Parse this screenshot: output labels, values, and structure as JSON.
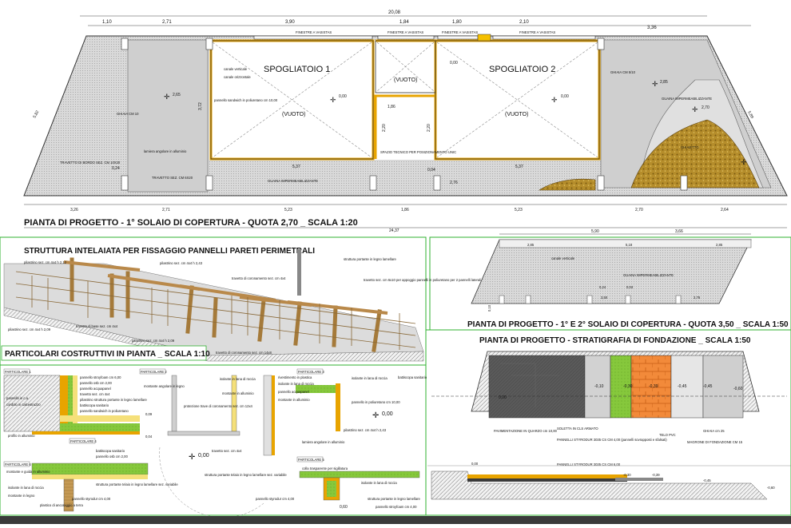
{
  "plan1": {
    "dims_top": {
      "total": "20,08",
      "d1": "1,10",
      "d2": "2,71",
      "d3": "3,90",
      "d4": "1,84",
      "d5": "1,80",
      "d6": "2,10",
      "d7": "3,36"
    },
    "windows": [
      "FINESTRE A VASISTAS",
      "FINESTRE A VASISTAS",
      "FINESTRE A VASISTAS",
      "FINESTRE A VASISTAS"
    ],
    "rooms": {
      "room1": "SPOGLIATOIO 1",
      "room2": "SPOGLIATOIO 2"
    },
    "void": "(VUOTO)",
    "levels": {
      "l265": "2,65",
      "l000": "0,00",
      "l285": "2,85",
      "l270": "2,70",
      "l276": "2,76",
      "l175": "1,75",
      "l024": "0,24",
      "l004": "0,04"
    },
    "side_dims": {
      "left": "5,82",
      "right": "5,89",
      "h372": "3,72",
      "h220": "2,20",
      "w186": "1,86"
    },
    "labels": {
      "trav_bordo": "TRAVETTO DI BORDO SEZ. CM 10X20",
      "pannello_sandwich": "pannello sandwich in poliuretano cm 10,00",
      "lamiera": "lamiera angolare in alluminio",
      "trav_6x20": "TRAVETTO SEZ. CM 6X20",
      "guaina_imp": "GUAINA IMPERMEABILIZZANTE",
      "guaina_imp2": "GUAINA IMPERMEABILIZZANTE",
      "spazio_tecnico": "SPAZIO TECNICO PER POSIZIONAMENTO UNIC",
      "ghiaia": "GHIAIA CM 10",
      "ghiaia_right": "GHIAIA CM 5/10",
      "ghiaietto": "GHIAIETTO",
      "tiny1": "canale verticale",
      "tiny2": "canale orizzontale"
    },
    "dims_bottom": {
      "b1": "3,26",
      "b2": "2,71",
      "b3": "5,23",
      "b4": "1,86",
      "b5": "5,23",
      "b6": "2,70",
      "b7": "2,64",
      "total": "24,37",
      "m537a": "5,37",
      "m537b": "5,37"
    },
    "title": "PIANTA DI PROGETTO - 1° SOLAIO DI COPERTURA - QUOTA 2,70 _ SCALA 1:20"
  },
  "frame": {
    "title": "STRUTTURA INTELAIATA PER FISSAGGIO PANNELLI PARETI PERIMETRALI",
    "labels": {
      "a": "pilastrino sez. cm 4x4 h 2,12",
      "b": "pilastrino sez. cm 4x4 h 2,43",
      "c": "travetto di coronamento sez. cm 4x4",
      "d": "struttura portante in legno lamellare",
      "e": "travetto sez. cm 6x10 per appoggio pannelli in poliuretano per 2 pannelli laterali e nel prospetto occidentale",
      "f": "pilastrino sez. cm 4x4 h 2,09",
      "g": "travetto di base sez. cm 4x4",
      "h": "pilastrino sez. cm 4x4 h 2,09",
      "i": "travetto di coronamento sez. cm 14x8"
    }
  },
  "plan2": {
    "dims": {
      "a": "5,90",
      "b": "3,66",
      "c": "2,85",
      "d": "5,18",
      "e": "2,85"
    },
    "labels": {
      "canale": "canale verticale",
      "guaina": "GUAINA IMPERMEABILIZZANTE"
    },
    "levels": {
      "a": "0,24",
      "b": "0,04",
      "c": "3,50",
      "d": "2,76",
      "e": "0,10"
    },
    "title": "PIANTA DI PROGETTO - 1° E 2° SOLAIO DI COPERTURA - QUOTA 3,50 _ SCALA 1:50"
  },
  "particolari": {
    "title": "PARTICOLARI COSTRUTTIVI IN PIANTA _ SCALA 1:10",
    "tags": [
      "PARTICOLARE 1",
      "PARTICOLARE 2",
      "PARTICOLARE 3",
      "PARTICOLARE 4",
      "PARTICOLARE 5",
      "PARTICOLARE 6"
    ],
    "levels": {
      "a": "0,00",
      "b": "0,00"
    },
    "labels": {
      "p1a": "pannello stroyfoam cm 6,00",
      "p1b": "pannello osb cm 2,00",
      "p1c": "pannello acquapanel",
      "p1d": "travetto sez. cm 4x4",
      "p1e": "pilastrino struttura portante in legno lamellare",
      "p1f": "battiscopa sanitario",
      "p1g": "pannello sandwich in poliuretano",
      "p1h": "cordolo in calcestruzzo",
      "p1i": "pannello in c.a.",
      "p1j": "profilo in alluminio",
      "p2a": "isolante in lana di roccia",
      "p2b": "montante angolare in legno",
      "p2c": "montante in alluminio",
      "p2d": "protezione trave di coronamento sez. cm 12x4",
      "p2e": "montante e guida in alluminio",
      "p3a": "rivestimento in plastica",
      "p3b": "isolante in lana di roccia",
      "p3c": "pannello acquapanel",
      "p3d": "montante in alluminio",
      "p4a": "isolante in lana di roccia",
      "p4b": "pannello in poliuretano cm 10,00",
      "p4c": "pilastrino sez. cm 4x4 h 2,43",
      "p4d": "lamiera angolare in alluminio",
      "p5a": "colla trasparente per sigillatura",
      "p5b": "isolante in lana di roccia",
      "p5c": "struttura portante in legno lamellare",
      "p5d": "pannello stroyfoam cm 4,00",
      "p6a": "struttura portante telaio in legno lamellare sez. variabile",
      "p6b": "montante in legno",
      "p6c": "pannello styrodur cm 4,00",
      "p6d": "plastico di ancoraggio a terra"
    },
    "dims": {
      "d1": "0,09",
      "d2": "0,04",
      "d3": "0,40",
      "d4": "0,09",
      "d5": "0,60"
    }
  },
  "fondazione": {
    "title": "PIANTA DI PROGETTO - STRATIGRAFIA DI FONDAZIONE _ SCALA 1:50",
    "levels": {
      "a": "0,00",
      "b": "-0,10",
      "c": "-0,30",
      "d": "-0,39",
      "e": "-0,45",
      "f": "-0,45",
      "g": "-0,60"
    },
    "labels": {
      "a": "PAVIMENTAZIONE IN QUARZO cm 10,00",
      "b": "SOLETTA IN CLS ARMATO",
      "c": "PANNELLI STYRODUR 3035 CS CM 4,00 (pannelli sovrapposti e sfalsati)",
      "d": "PANNELLI STYRODUR 3035 CS CM 6,00",
      "e": "TELO PVC",
      "f": "GHIAIA cm 25",
      "g": "MAGRONE DI FONDAZIONE CM 15"
    },
    "section_levels": [
      "0,00",
      "-0,30",
      "-0,39",
      "-0,45",
      "-0,60"
    ]
  }
}
